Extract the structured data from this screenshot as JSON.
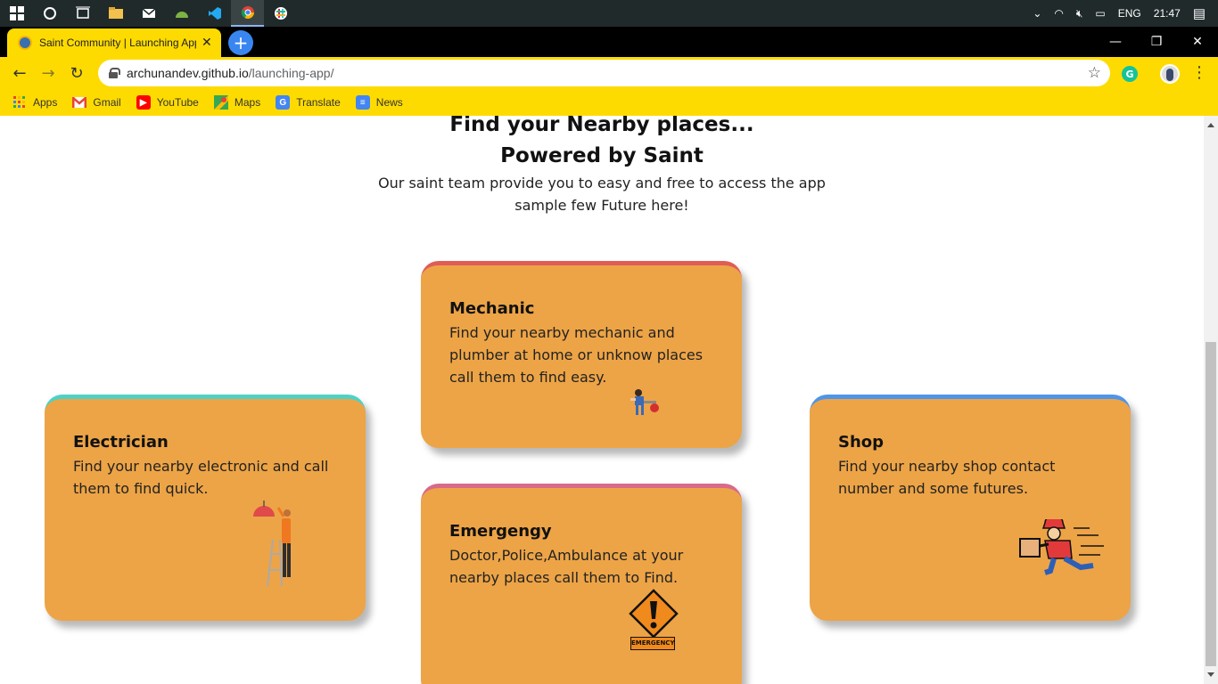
{
  "taskbar": {
    "language": "ENG",
    "time": "21:47"
  },
  "browser": {
    "tab_title": "Saint Community | Launching App",
    "url_domain": "archunandev.github.io",
    "url_path": "/launching-app/",
    "bookmarks": [
      {
        "label": "Apps",
        "icon": "apps-grid-icon"
      },
      {
        "label": "Gmail",
        "icon": "gmail-icon"
      },
      {
        "label": "YouTube",
        "icon": "youtube-icon"
      },
      {
        "label": "Maps",
        "icon": "maps-icon"
      },
      {
        "label": "Translate",
        "icon": "translate-icon"
      },
      {
        "label": "News",
        "icon": "news-icon"
      }
    ]
  },
  "page": {
    "heading_line1": "Find your Nearby places...",
    "heading_line2": "Powered by Saint",
    "subtitle_line1": "Our saint team provide you to easy and free to access the app",
    "subtitle_line2": "sample few Future here!",
    "cards": {
      "mechanic": {
        "title": "Mechanic",
        "description": "Find your nearby mechanic and plumber at home or unknow places call them to find easy.",
        "accent": "#e05d57"
      },
      "electrician": {
        "title": "Electrician",
        "description": "Find your nearby electronic and call them to find quick.",
        "accent": "#4fd1c5"
      },
      "emergency": {
        "title": "Emergengy",
        "description": "Doctor,Police,Ambulance at your nearby places call them to Find.",
        "accent": "#d96a8a",
        "sign_text": "EMERGENCY"
      },
      "shop": {
        "title": "Shop",
        "description": "Find your nearby shop contact number and some futures.",
        "accent": "#4f95e8"
      }
    },
    "card_color": "#eda446"
  }
}
